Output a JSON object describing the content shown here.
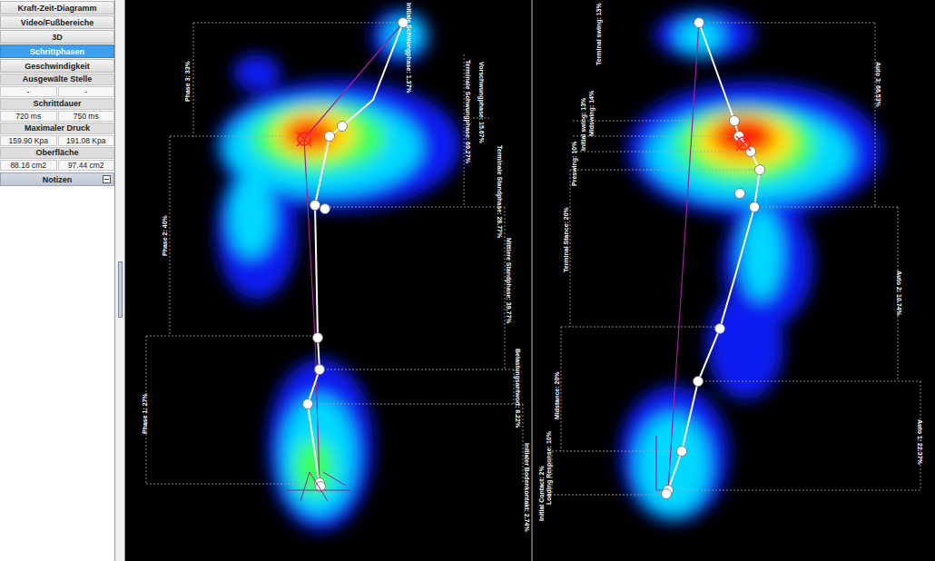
{
  "sidebar": {
    "buttons": [
      {
        "label": "Kraft-Zeit-Diagramm",
        "selected": false
      },
      {
        "label": "Video/Fußbereiche",
        "selected": false
      },
      {
        "label": "3D",
        "selected": false
      },
      {
        "label": "Schrittphasen",
        "selected": true
      },
      {
        "label": "Geschwindigkeit",
        "selected": false
      }
    ],
    "info": [
      {
        "label": "Ausgewälte Stelle",
        "values": [
          "-",
          "-"
        ]
      },
      {
        "label": "Schrittdauer",
        "values": [
          "720 ms",
          "750 ms"
        ]
      },
      {
        "label": "Maximaler Druck",
        "values": [
          "159.90 Kpa",
          "191.08 Kpa"
        ]
      },
      {
        "label": "Oberfläche",
        "values": [
          "88.16 cm2",
          "97.44 cm2"
        ]
      }
    ],
    "notes": {
      "label": "Notizen"
    }
  },
  "feet": [
    {
      "side": "left",
      "labels": [
        "Initiale Schwungphase: 1.37%",
        "Terminale Schwungphase: 69.27%",
        "Vorschwungphase: 15.67%",
        "Terminale Standphase: 28.77%",
        "Mittlere Standphase: 39.77%",
        "Belastungsantwort: 8.22%",
        "Initialer Bodenkontakt: 2.74%",
        "Phase 3: 33%",
        "Phase 2: 40%",
        "Phase 1: 27%"
      ]
    },
    {
      "side": "right",
      "labels": [
        "Terminal swing: 13%",
        "Midswing: 14%",
        "Initial swing: 13%",
        "Preswing: 10%",
        "Terminal Stance: 20%",
        "Midstance: 20%",
        "Loading Response: 10%",
        "Initial Contact: 2%",
        "Auto 3: 66.53%",
        "Auto 2: 10.74%",
        "Auto 1: 22.37%"
      ]
    }
  ]
}
